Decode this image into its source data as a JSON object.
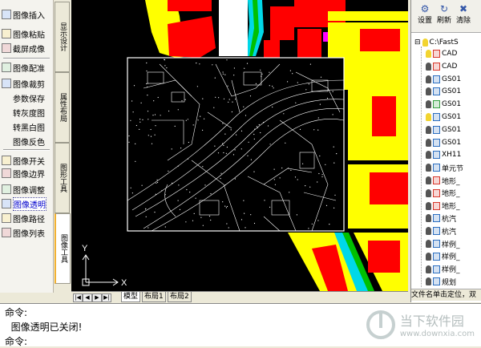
{
  "left_tools": {
    "items": [
      {
        "label": "图像插入",
        "icon": "image-insert-icon"
      },
      {
        "label": "图像粘贴",
        "icon": "image-paste-icon"
      },
      {
        "label": "截屏成像",
        "icon": "screenshot-icon"
      },
      {
        "label": "图像配准",
        "icon": "image-register-icon"
      },
      {
        "label": "图像裁剪",
        "icon": "image-crop-icon"
      },
      {
        "label": "参数保存",
        "icon": ""
      },
      {
        "label": "转灰度图",
        "icon": ""
      },
      {
        "label": "转黑白图",
        "icon": ""
      },
      {
        "label": "图像反色",
        "icon": ""
      },
      {
        "label": "图像开关",
        "icon": "image-toggle-icon"
      },
      {
        "label": "图像边界",
        "icon": "image-border-icon"
      },
      {
        "label": "图像调整",
        "icon": "image-adjust-icon"
      },
      {
        "label": "图像透明",
        "icon": "image-transparency-icon"
      },
      {
        "label": "图像路径",
        "icon": "image-path-icon"
      },
      {
        "label": "图像列表",
        "icon": "image-list-icon"
      }
    ]
  },
  "vertical_tabs": [
    {
      "label": "显示设计"
    },
    {
      "label": "属性布局"
    },
    {
      "label": "图形工具"
    },
    {
      "label": "图像工具"
    }
  ],
  "layout_tabs": {
    "nav": [
      "|◀",
      "◀",
      "▶",
      "▶|"
    ],
    "tabs": [
      "模型",
      "布局1",
      "布局2"
    ]
  },
  "canvas": {
    "axis_x": "X",
    "axis_y": "Y",
    "colors": {
      "yellow": "#ffff00",
      "red": "#ff0000",
      "cyan": "#00d8e8",
      "magenta": "#ff00ff",
      "green": "#00c000",
      "black": "#000000"
    }
  },
  "right_panel": {
    "toolbar": [
      {
        "label": "设置",
        "icon": "settings-icon"
      },
      {
        "label": "刷新",
        "icon": "refresh-icon"
      },
      {
        "label": "清除",
        "icon": "clear-icon"
      }
    ],
    "root": "C:\\FastS",
    "files": [
      {
        "name": "CAD",
        "lamp": "on"
      },
      {
        "name": "CAD",
        "lamp": "off"
      },
      {
        "name": "GS01",
        "lamp": "off"
      },
      {
        "name": "GS01",
        "lamp": "off"
      },
      {
        "name": "GS01",
        "lamp": "off"
      },
      {
        "name": "GS01",
        "lamp": "on"
      },
      {
        "name": "GS01",
        "lamp": "off"
      },
      {
        "name": "GS01",
        "lamp": "off"
      },
      {
        "name": "XH11",
        "lamp": "off"
      },
      {
        "name": "单元节",
        "lamp": "off"
      },
      {
        "name": "地形_",
        "lamp": "off"
      },
      {
        "name": "地形_",
        "lamp": "off"
      },
      {
        "name": "地形_",
        "lamp": "off"
      },
      {
        "name": "杭汽",
        "lamp": "off"
      },
      {
        "name": "杭汽",
        "lamp": "off"
      },
      {
        "name": "样例_",
        "lamp": "off"
      },
      {
        "name": "样例_",
        "lamp": "off"
      },
      {
        "name": "样例_",
        "lamp": "off"
      },
      {
        "name": "规划",
        "lamp": "off"
      }
    ],
    "status": "文件名单击定位，双"
  },
  "command": {
    "lines": [
      "命令:",
      "  图像透明已关闭!",
      "命令:"
    ]
  },
  "watermark": {
    "title": "当下软件园",
    "url": "www.downxia.com"
  }
}
